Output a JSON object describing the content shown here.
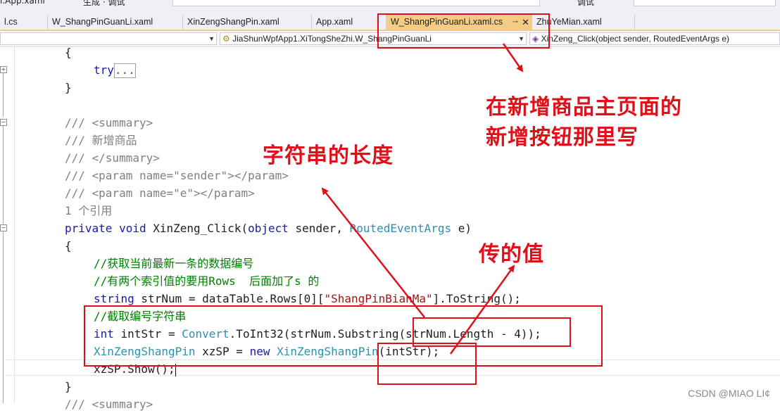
{
  "top_strip": {
    "fragment_left": "i.App.xaml",
    "fragment_mid": "生成 · 调试",
    "fragment_right": "调试"
  },
  "tabs": [
    {
      "label": "l.cs",
      "active": false
    },
    {
      "label": "W_ShangPinGuanLi.xaml",
      "active": false
    },
    {
      "label": "XinZengShangPin.xaml",
      "active": false
    },
    {
      "label": "App.xaml",
      "active": false
    },
    {
      "label": "W_ShangPinGuanLi.xaml.cs",
      "active": true,
      "pin": "⊸",
      "close": "✕"
    },
    {
      "label": "ZhuYeMian.xaml",
      "active": false
    }
  ],
  "nav": {
    "class_selector": "JiaShunWpfApp1.XiTongSheZhi.W_ShangPinGuanLi",
    "member_selector": "XinZeng_Click(object sender, RoutedEventArgs e)"
  },
  "code": {
    "l1": "{",
    "l2_kw": "try",
    "l2_dots": "...",
    "l3": "}",
    "l5": "/// <summary>",
    "l6": "/// 新增商品",
    "l7": "/// </summary>",
    "l8a": "/// <param name=",
    "l8b": "\"sender\"",
    "l8c": "></param>",
    "l9a": "/// <param name=",
    "l9b": "\"e\"",
    "l9c": "></param>",
    "l10": "1 个引用",
    "l11a": "private",
    "l11b": " ",
    "l11c": "void",
    "l11d": " XinZeng_Click(",
    "l11e": "object",
    "l11f": " sender, ",
    "l11g": "RoutedEventArgs",
    "l11h": " e)",
    "l12": "{",
    "l13": "//获取当前最新一条的数据编号",
    "l14": "//有两个索引值的要用Rows  后面加了s 的",
    "l15a": "string",
    "l15b": " strNum = dataTable.Rows[0][",
    "l15c": "\"ShangPinBianMa\"",
    "l15d": "].ToString();",
    "l16": "//截取编号字符串",
    "l17a": "int",
    "l17b": " intStr = ",
    "l17c": "Convert",
    "l17d": ".ToInt32(strNum.Substring(strNum.Length - 4));",
    "l18a": "XinZengShangPin",
    "l18b": " xzSP = ",
    "l18c": "new",
    "l18d": " ",
    "l18e": "XinZengShangPin",
    "l18f": "(intStr);",
    "l19": "xzSP.Show();",
    "l20": "}",
    "l21": "/// <summary>"
  },
  "annotations": {
    "main_note_line1": "在新增商品主页面的",
    "main_note_line2": "新增按钮那里写",
    "length_note": "字符串的长度",
    "value_note": "传的值",
    "color": "#e0101a"
  },
  "watermark": "CSDN @MIAO     LI¢"
}
